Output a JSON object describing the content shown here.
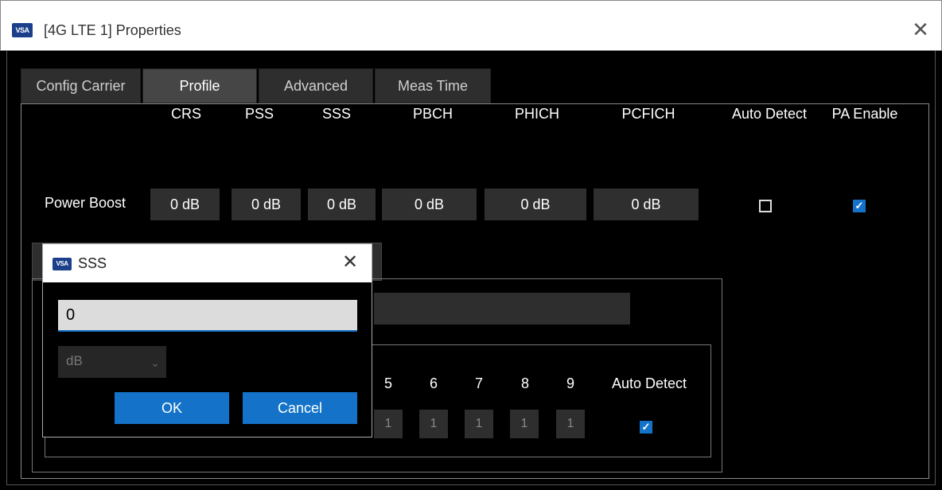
{
  "window": {
    "title": "[4G LTE 1] Properties",
    "icon_text": "VSA",
    "close_glyph": "✕"
  },
  "tabs": [
    {
      "label": "Config Carrier"
    },
    {
      "label": "Profile"
    },
    {
      "label": "Advanced"
    },
    {
      "label": "Meas Time"
    }
  ],
  "active_tab": "Profile",
  "power_boost": {
    "row_label": "Power Boost",
    "columns": [
      "CRS",
      "PSS",
      "SSS",
      "PBCH",
      "PHICH",
      "PCFICH",
      "Auto Detect",
      "PA Enable"
    ],
    "values": [
      "0 dB",
      "0 dB",
      "0 dB",
      "0 dB",
      "0 dB",
      "0 dB"
    ],
    "auto_detect": false,
    "pa_enable": true
  },
  "subframe_table": {
    "headers": [
      "5",
      "6",
      "7",
      "8",
      "9",
      "Auto Detect"
    ],
    "values": [
      "1",
      "1",
      "1",
      "1",
      "1"
    ],
    "auto_detect": true
  },
  "dialog": {
    "title": "SSS",
    "icon_text": "VSA",
    "close_glyph": "✕",
    "input_value": "0",
    "unit": "dB",
    "ok_label": "OK",
    "cancel_label": "Cancel"
  },
  "colors": {
    "accent": "#1473c8",
    "icon": "#1c3f8c",
    "background": "#000000"
  }
}
